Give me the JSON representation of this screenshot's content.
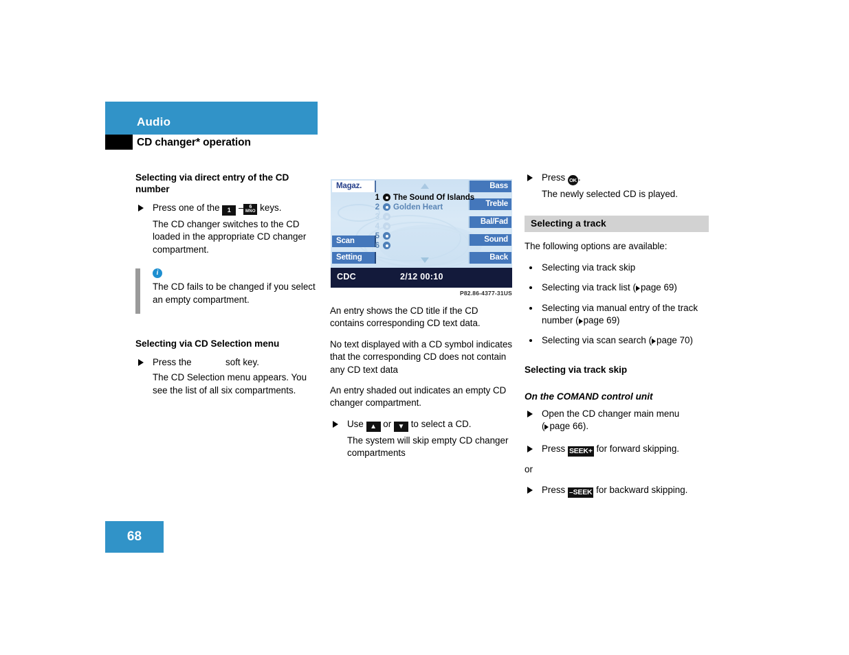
{
  "header": {
    "chapter": "Audio",
    "section": "CD changer* operation",
    "band_color": "#3193c8"
  },
  "left_column": {
    "heading1": "Selecting via direct entry of the CD number",
    "step1_prefix": "Press one of the",
    "step1_dash": "–",
    "step1_suffix": "keys.",
    "key_num": "1",
    "key_abc_num": "6",
    "key_abc_letters": "MNO",
    "step1_result": "The CD changer switches to the CD loaded in the appropriate CD changer compartment.",
    "note_icon": "info-icon",
    "note_text": "The CD fails to be changed if you select an empty compartment.",
    "heading2": "Selecting via CD Selection menu",
    "step2_prefix": "Press the",
    "step2_suffix": "soft key.",
    "step2_result": "The CD Selection menu appears. You see the list of all six compartments."
  },
  "display": {
    "softkeys_left": [
      "Magaz.",
      "Scan",
      "Setting"
    ],
    "softkeys_right": [
      "Bass",
      "Treble",
      "Bal/Fad",
      "Sound",
      "Back"
    ],
    "cd_list": [
      {
        "num": "1",
        "title": "The Sound Of Islands",
        "state": "selected"
      },
      {
        "num": "2",
        "title": "Golden Heart",
        "state": "loaded"
      },
      {
        "num": "3",
        "title": "",
        "state": "empty"
      },
      {
        "num": "4",
        "title": "",
        "state": "empty"
      },
      {
        "num": "5",
        "title": "",
        "state": "loaded"
      },
      {
        "num": "6",
        "title": "",
        "state": "loaded"
      }
    ],
    "status_source": "CDC",
    "status_track": "2/12  00:10",
    "caption": "P82.86-4377-31US"
  },
  "mid_column": {
    "para1": "An entry shows the CD title if the CD contains corresponding CD text data.",
    "para2": "No text displayed with a CD symbol indicates that the corresponding CD does not contain any CD text data",
    "para3": "An entry shaded out indicates an empty CD changer compartment.",
    "step_use": "Use",
    "step_or": "or",
    "step_select": "to select a CD.",
    "step_result": "The system will skip empty CD changer compartments"
  },
  "right_column": {
    "step_press": "Press",
    "key_ok": "OK",
    "step_press_end": ".",
    "step_press_result": "The newly selected CD is played.",
    "band_heading": "Selecting a track",
    "intro": "The following options are available:",
    "bullets": [
      {
        "text": "Selecting via track skip",
        "ref": ""
      },
      {
        "text": "Selecting via track list",
        "ref": "page 69"
      },
      {
        "text": "Selecting via manual entry of the track number",
        "ref": "page 69"
      },
      {
        "text": "Selecting via scan search",
        "ref": "page 70"
      }
    ],
    "heading_skip": "Selecting via track skip",
    "subheading_comand": "On the COMAND control unit",
    "step_open": "Open the CD changer main menu",
    "step_open_ref": "page 66",
    "step_seek_fwd_prefix": "Press",
    "key_seek_plus": "SEEK+",
    "step_seek_fwd_suffix": "for forward skipping.",
    "or_label": "or",
    "step_seek_back_prefix": "Press",
    "key_seek_minus": "–SEEK",
    "step_seek_back_suffix": "for backward skipping."
  },
  "footer": {
    "page_number": "68"
  }
}
